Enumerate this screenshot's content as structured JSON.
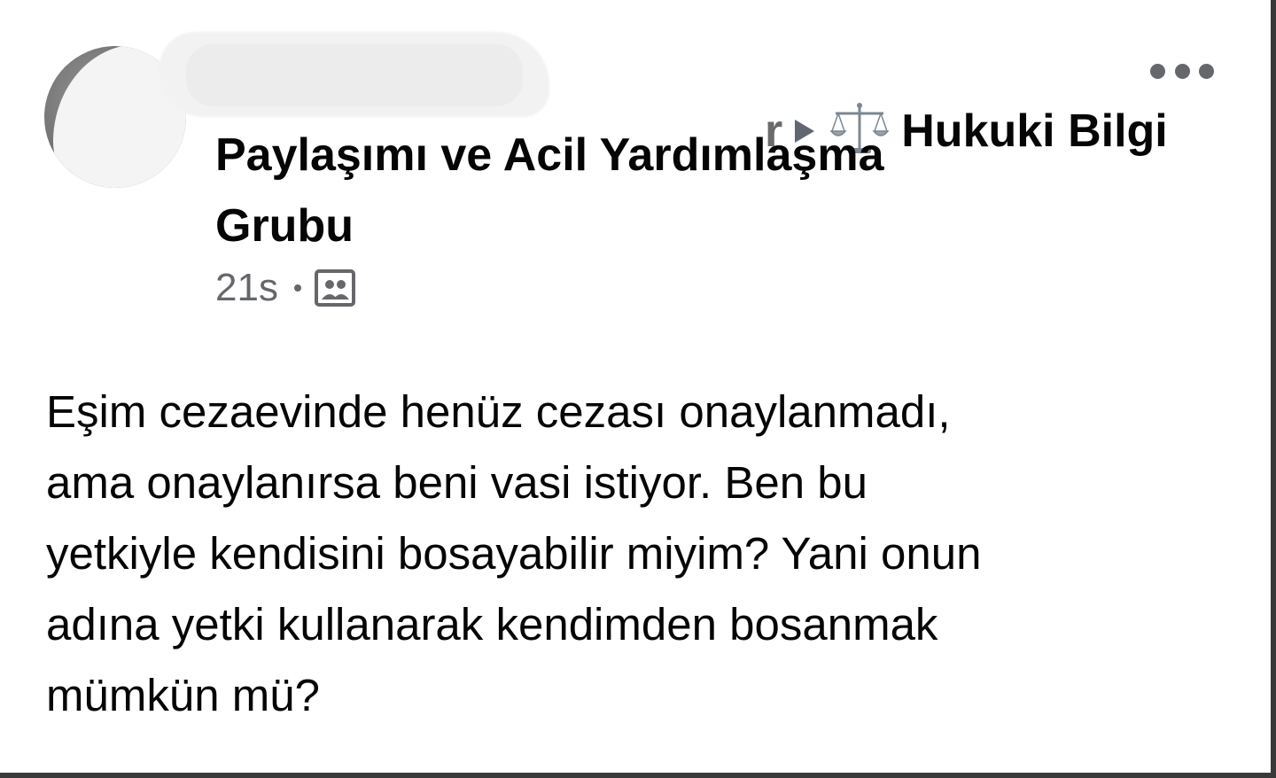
{
  "post": {
    "author_partial": "r",
    "group_name_line1": "Hukuki Bilgi",
    "group_name_line2": "Paylaşımı ve Acil Yardımlaşma",
    "group_name_line3": "Grubu",
    "timestamp": "21s",
    "body_line1": "Eşim cezaevinde henüz cezası onaylanmadı,",
    "body_line2": "ama onaylanırsa beni vasi istiyor. Ben bu",
    "body_line3": "yetkiyle kendisini bosayabilir miyim? Yani onun",
    "body_line4": "adına yetki kullanarak kendimden bosanmak",
    "body_line5": "mümkün mü?"
  },
  "icons": {
    "group_icon": "scale-icon",
    "arrow": "play-arrow-icon",
    "privacy": "group-privacy-icon",
    "more": "more-options-icon"
  },
  "colors": {
    "text": "#050505",
    "secondary": "#65676b",
    "background": "#ffffff"
  }
}
